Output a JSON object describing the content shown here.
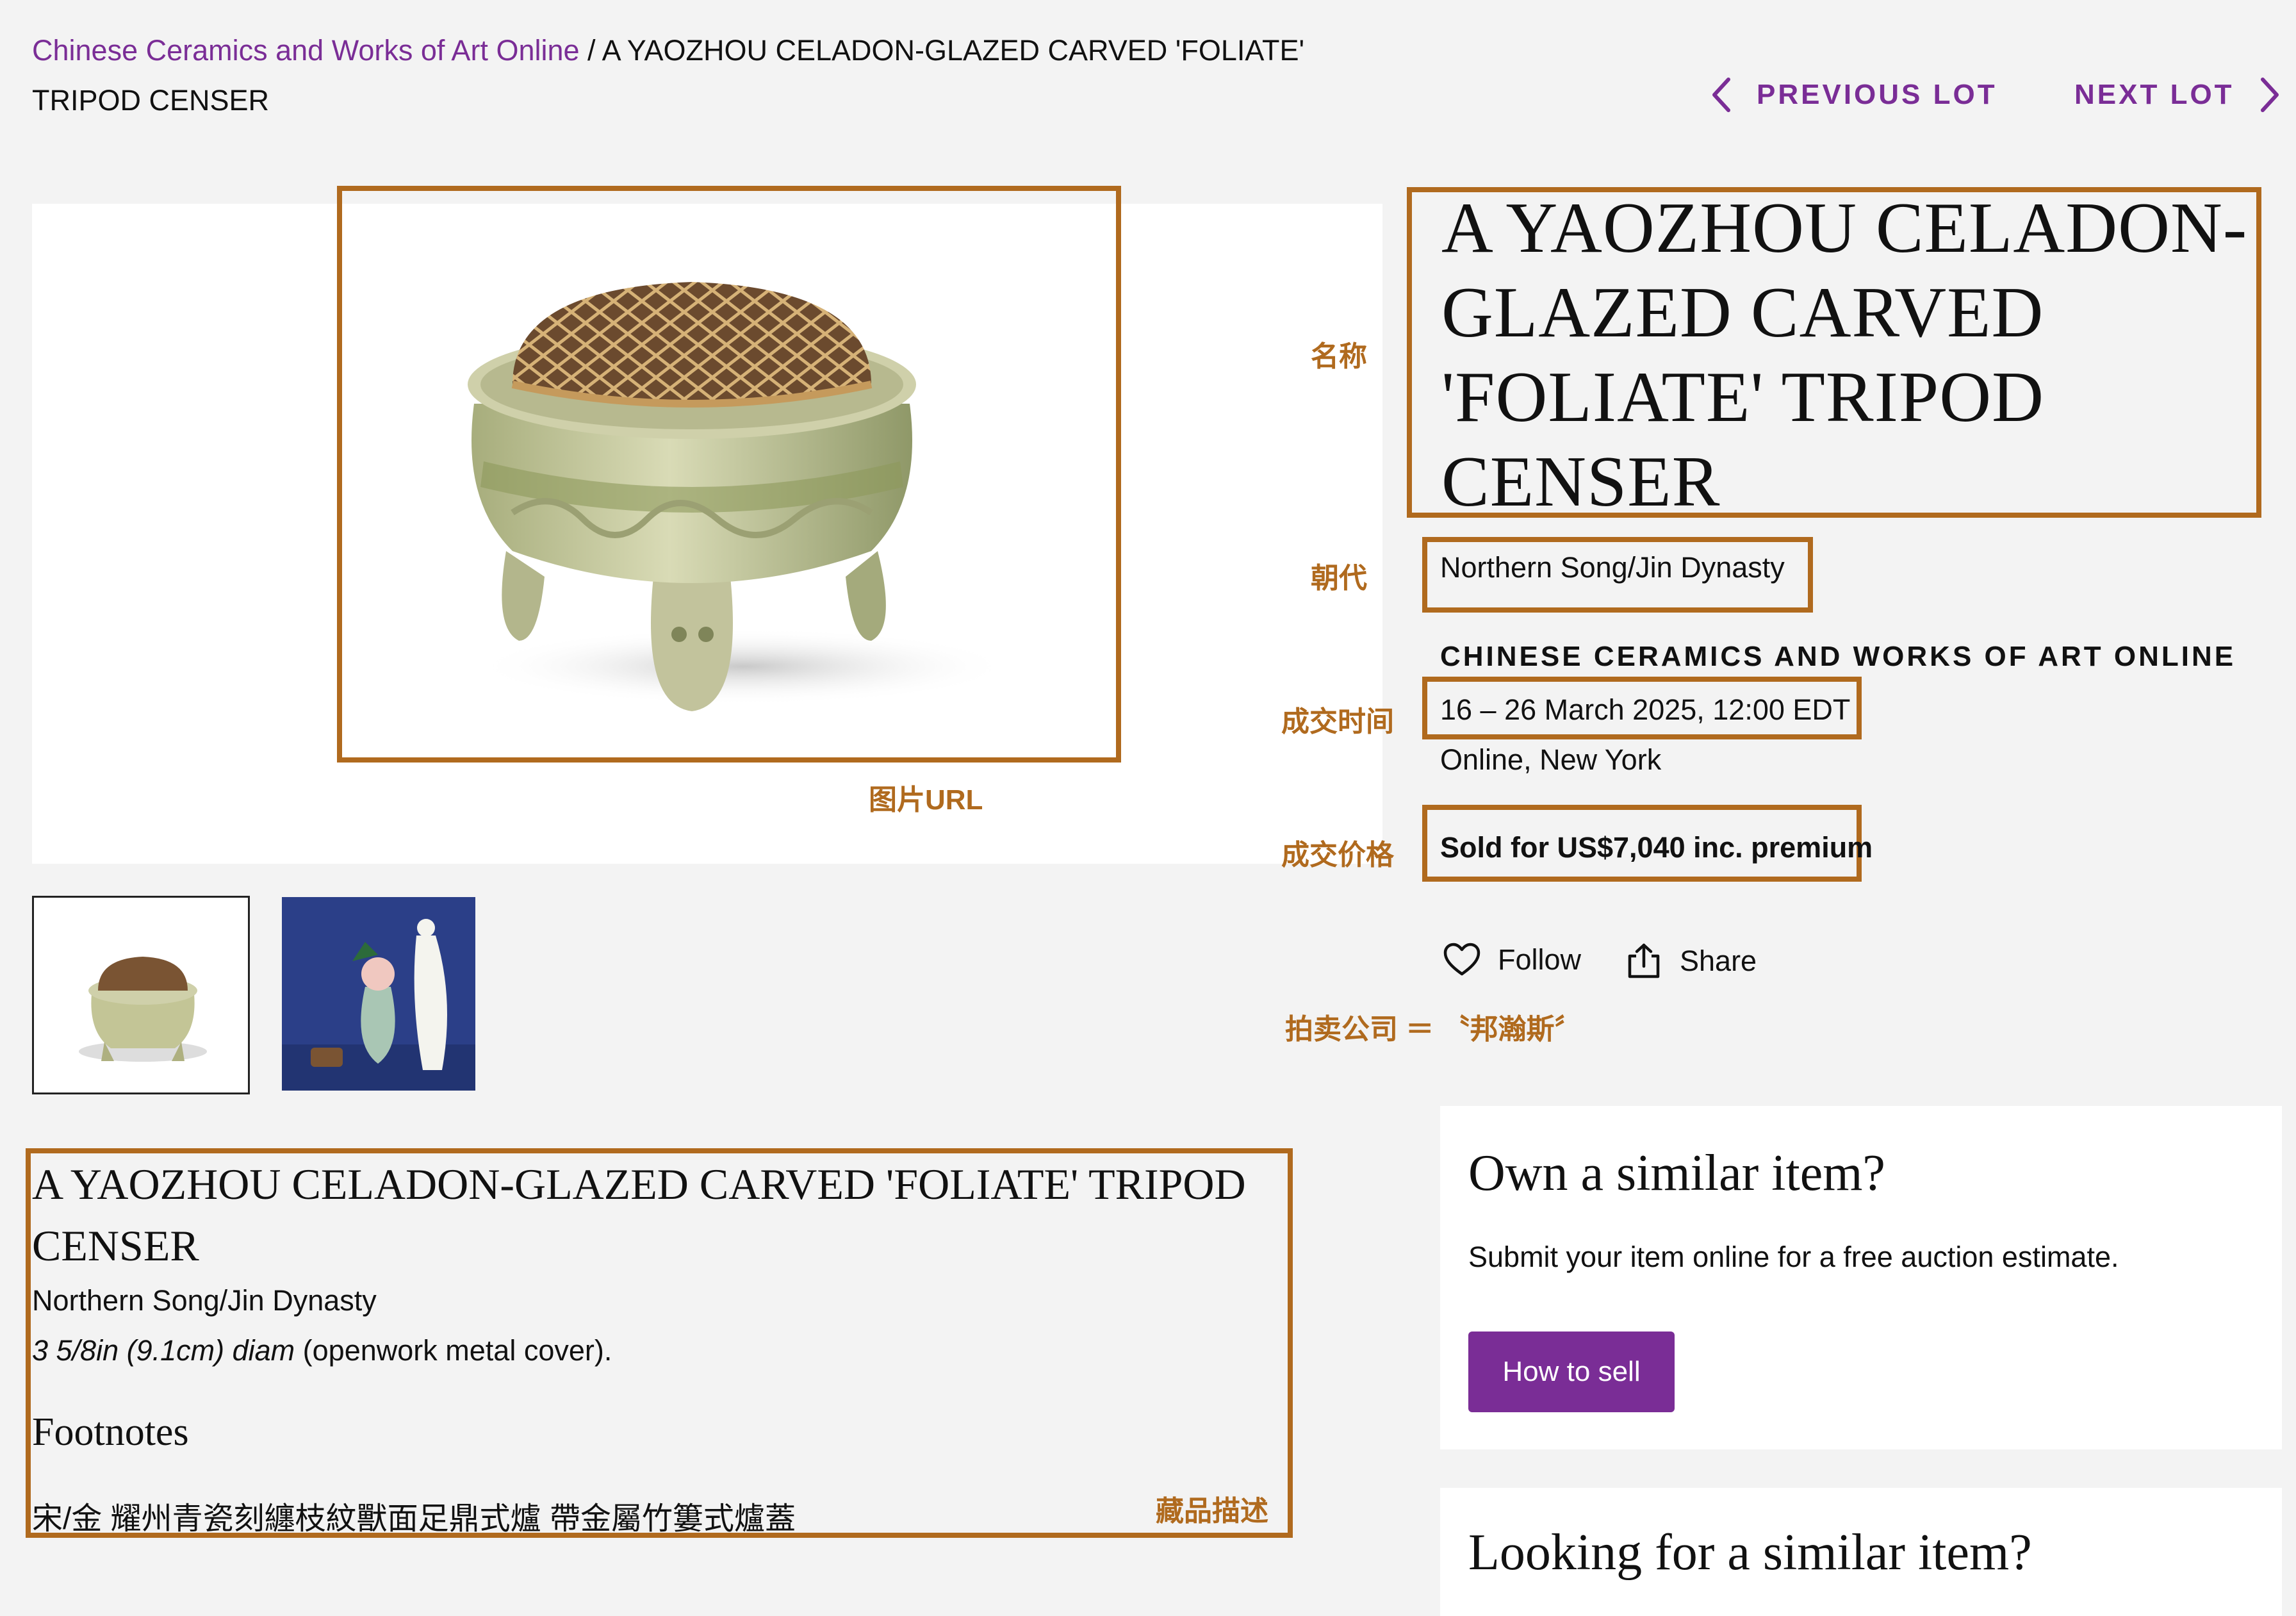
{
  "breadcrumb": {
    "link": "Chinese Ceramics and Works of Art Online",
    "separator": " / ",
    "current": "A YAOZHOU CELADON-GLAZED CARVED 'FOLIATE' TRIPOD CENSER"
  },
  "nav": {
    "previous": "PREVIOUS LOT",
    "next": "NEXT LOT"
  },
  "lot": {
    "title": "A YAOZHOU CELADON-GLAZED CARVED 'FOLIATE' TRIPOD CENSER",
    "dynasty": "Northern Song/Jin Dynasty",
    "sale_name": "CHINESE CERAMICS AND WORKS OF ART ONLINE",
    "sale_date": "16 – 26 March 2025, 12:00 EDT",
    "sale_location": "Online, New York",
    "sold": "Sold for US$7,040 inc. premium"
  },
  "actions": {
    "follow": "Follow",
    "share": "Share"
  },
  "annotations": {
    "name": "名称",
    "dynasty": "朝代",
    "date": "成交时间",
    "price": "成交价格",
    "image_url": "图片URL",
    "auction_house": "拍卖公司 ＝ 〝邦瀚斯〞",
    "description": "藏品描述"
  },
  "description": {
    "title": "A YAOZHOU CELADON-GLAZED CARVED 'FOLIATE' TRIPOD CENSER",
    "dynasty": "Northern Song/Jin Dynasty",
    "size_italic": "3 5/8in (9.1cm) diam",
    "size_rest": " (openwork metal cover).",
    "footnotes_heading": "Footnotes",
    "chinese_title": "宋/金 耀州青瓷刻纏枝紋獸面足鼎式爐 帶金屬竹簍式爐蓋"
  },
  "sell_card": {
    "title": "Own a similar item?",
    "text": "Submit your item online for a free auction estimate.",
    "button": "How to sell"
  },
  "buy_card": {
    "title": "Looking for a similar item?"
  },
  "colors": {
    "accent": "#7a2d96",
    "annotation": "#b06a1e",
    "background": "#f3f3f3"
  }
}
